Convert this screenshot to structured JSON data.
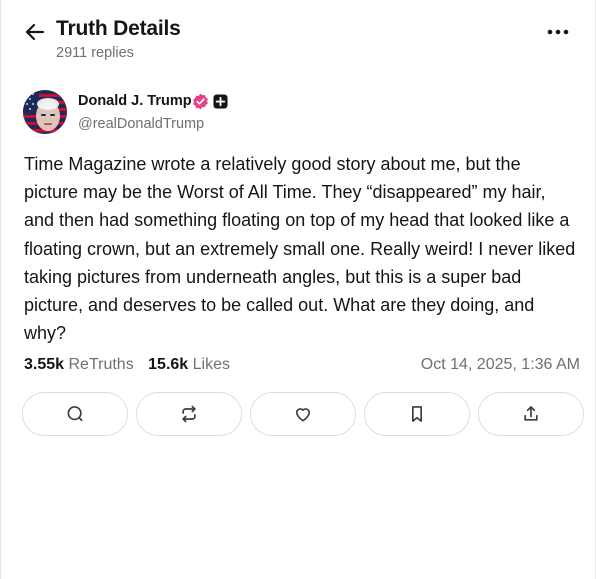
{
  "header": {
    "title": "Truth Details",
    "replies": "2911 replies",
    "back_icon": "arrow-left-icon",
    "more_icon": "more-horizontal-icon"
  },
  "author": {
    "name": "Donald J. Trump",
    "handle": "@realDonaldTrump",
    "verified_icon": "verified-badge-icon",
    "plus_icon": "plus-square-icon"
  },
  "post": {
    "text": "Time Magazine wrote a relatively good story about me, but the picture may be the Worst of All Time. They “disappeared” my hair, and then had something floating on top of my head that looked like a floating crown, but an extremely small one. Really weird! I never liked taking pictures from underneath angles, but this is a super bad picture, and deserves to be called out. What are they doing, and why?"
  },
  "stats": {
    "retruths_count": "3.55k",
    "retruths_label": "ReTruths",
    "likes_count": "15.6k",
    "likes_label": "Likes",
    "timestamp": "Oct 14, 2025, 1:36 AM"
  },
  "actions": [
    {
      "name": "reply",
      "icon": "comment-icon"
    },
    {
      "name": "retruth",
      "icon": "repost-icon"
    },
    {
      "name": "like",
      "icon": "heart-icon"
    },
    {
      "name": "bookmark",
      "icon": "bookmark-icon"
    },
    {
      "name": "share",
      "icon": "share-icon"
    }
  ],
  "colors": {
    "text": "#14151a",
    "muted": "#6e7078",
    "verified": "#e83e8c",
    "border": "#dcdde2"
  }
}
